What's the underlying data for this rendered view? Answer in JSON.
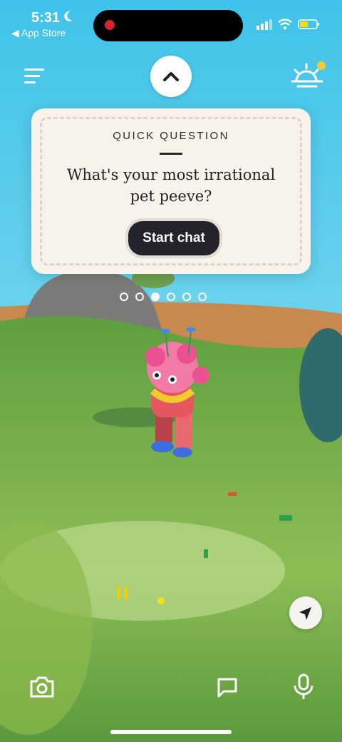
{
  "status_bar": {
    "time": "5:31",
    "back_label": "◀ App Store"
  },
  "prompt_card": {
    "eyebrow": "QUICK QUESTION",
    "question": "What's your most irrational pet peeve?",
    "button_label": "Start chat"
  },
  "pager": {
    "total": 6,
    "active_index": 2
  },
  "colors": {
    "sky": "#4cc6ea",
    "grass": "#6aa845",
    "card": "#f7f3ea",
    "button": "#24232c"
  },
  "icons": [
    "menu-icon",
    "chevron-up-icon",
    "sunrise-icon",
    "camera-icon",
    "chat-bubble-icon",
    "microphone-icon",
    "navigation-arrow-icon"
  ]
}
